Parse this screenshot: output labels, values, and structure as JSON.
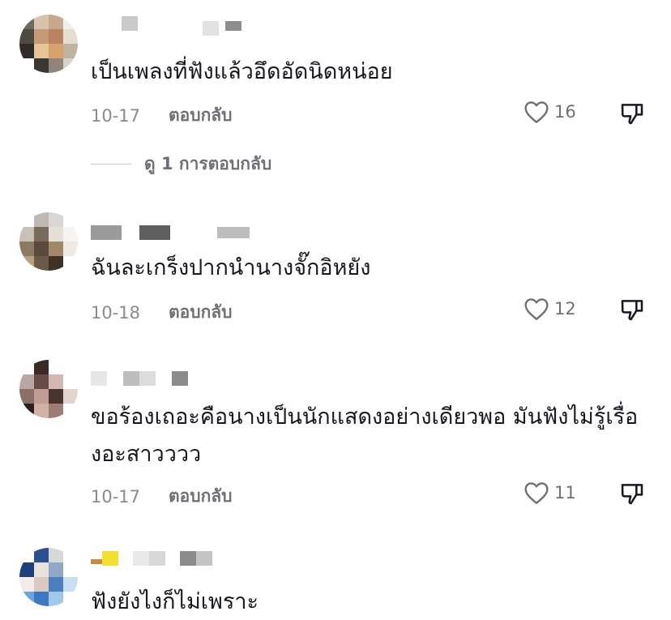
{
  "comments": [
    {
      "text": "เป็นเพลงที่ฟังแล้วอึดอัดนิดหน่อย",
      "date": "10-17",
      "reply_label": "ตอบกลับ",
      "likes": "16",
      "view_replies": "ดู 1 การตอบกลับ"
    },
    {
      "text": "ฉันละเกร็งปากนำนางจั๊กอิหยัง",
      "date": "10-18",
      "reply_label": "ตอบกลับ",
      "likes": "12"
    },
    {
      "text": "ขอร้องเถอะคือนางเป็นนักแสดงอย่างเดียวพอ มันฟังไม่รู้เรื่องอะสาวววว",
      "date": "10-17",
      "reply_label": "ตอบกลับ",
      "likes": "11"
    },
    {
      "text": "ฟังยังไงก็ไม่เพราะ"
    }
  ],
  "icons": {
    "like": "heart-outline-icon",
    "dislike": "thumbs-down-icon"
  },
  "colors": {
    "text": "#161823",
    "meta": "#8a8b91",
    "action": "#6f7077"
  }
}
